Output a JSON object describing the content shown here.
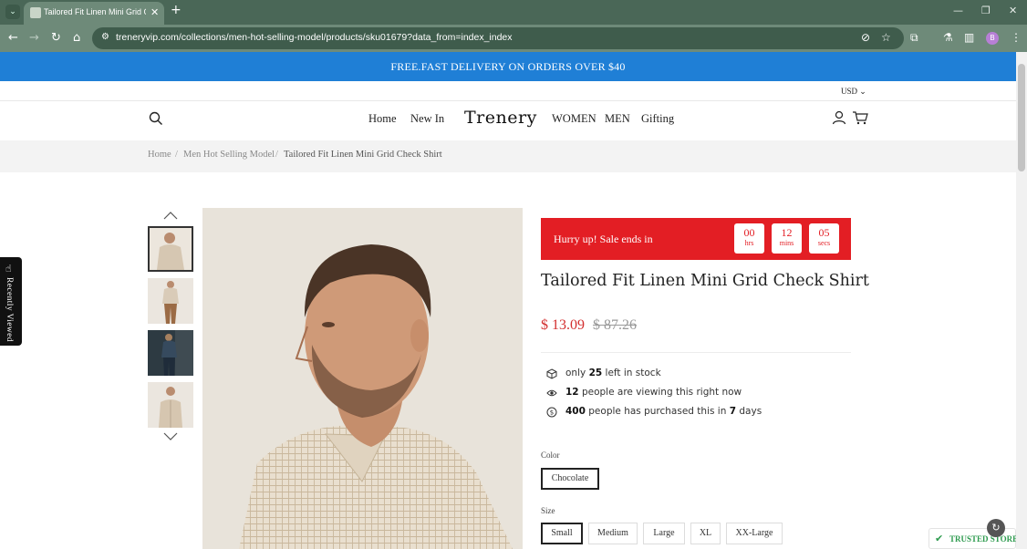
{
  "browser": {
    "tab_title": "Tailored Fit Linen Mini Grid Check Shirt",
    "url": "treneryvip.com/collections/men-hot-selling-model/products/sku01679?data_from=index_index",
    "avatar_letter": "B"
  },
  "promo_banner": "FREE.FAST DELIVERY ON ORDERS OVER $40",
  "currency": "USD",
  "nav": {
    "logo": "Trenery",
    "left_items": [
      "Home",
      "New In"
    ],
    "right_items": [
      "WOMEN",
      "MEN",
      "Gifting"
    ]
  },
  "breadcrumb": {
    "items": [
      "Home",
      "Men Hot Selling Model",
      "Tailored Fit Linen Mini Grid Check Shirt"
    ],
    "separator": "/"
  },
  "recently_viewed": "Recently Viewed",
  "sale": {
    "text": "Hurry up!  Sale ends in",
    "hours": "00",
    "hours_label": "hrs",
    "mins": "12",
    "mins_label": "mins",
    "secs": "05",
    "secs_label": "secs"
  },
  "product": {
    "title": "Tailored Fit Linen Mini Grid Check Shirt",
    "price": "$ 13.09",
    "old_price": "$ 87.26"
  },
  "stats": {
    "stock_pre": "only",
    "stock_num": "25",
    "stock_post": "left in stock",
    "view_num": "12",
    "view_post": "people are viewing this right now",
    "buy_num": "400",
    "buy_mid": "people has purchased this in",
    "buy_days": "7",
    "buy_post": "days"
  },
  "color": {
    "label": "Color",
    "options": [
      "Chocolate"
    ],
    "selected": "Chocolate"
  },
  "size": {
    "label": "Size",
    "options": [
      "Small",
      "Medium",
      "Large",
      "XL",
      "XX-Large"
    ],
    "selected": "Small"
  },
  "trusted_store": "TRUSTED STORE",
  "colors": {
    "promo_blue": "#1f7fd6",
    "sale_red": "#e31e24",
    "price_red": "#d32f2f",
    "trusted_green": "#2e9b4f",
    "chrome_green": "#6e8a79"
  }
}
